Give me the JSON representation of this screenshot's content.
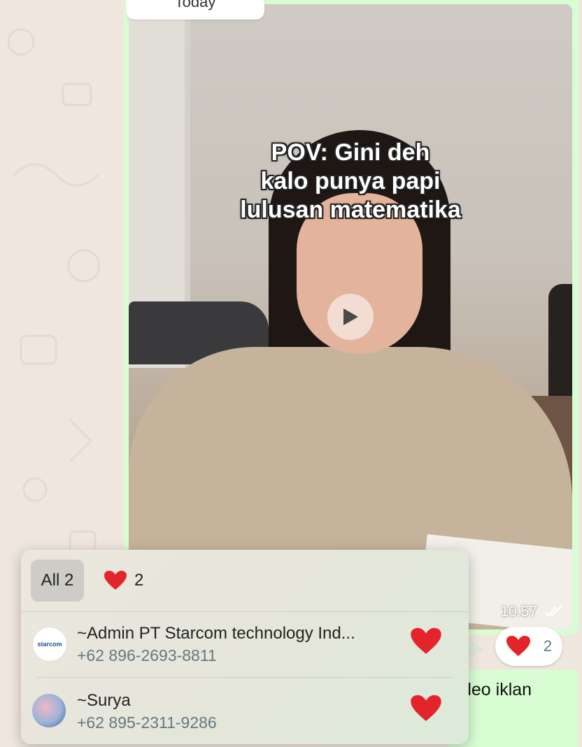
{
  "date_chip": "Today",
  "video": {
    "caption_lines": [
      "POV: Gini deh",
      "kalo punya papi",
      "lulusan matematika"
    ],
    "time": "10.57"
  },
  "reaction_pill": {
    "emoji": "❤️",
    "count": "2"
  },
  "next_message_partial": "deo iklan",
  "popup": {
    "tab_all": "All 2",
    "tab_heart_count": "2",
    "reactors": [
      {
        "name": "~Admin PT Starcom technology Ind...",
        "phone": "+62 896-2693-8811",
        "avatar_text": "starcom"
      },
      {
        "name": "~Surya",
        "phone": "+62 895-2311-9286"
      }
    ]
  },
  "colors": {
    "outgoing_bubble": "#d9fdd3",
    "heart": "#e3242b",
    "muted_text": "#667781"
  }
}
